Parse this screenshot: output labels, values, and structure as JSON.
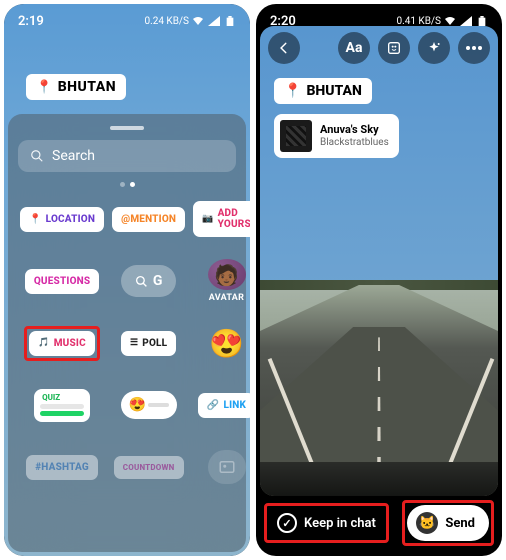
{
  "phone1": {
    "status": {
      "time": "2:19",
      "data": "0.24 KB/S"
    },
    "location": "BHUTAN",
    "search": {
      "placeholder": "Search"
    },
    "stickers": {
      "location": "LOCATION",
      "mention": "@MENTION",
      "add_yours": "ADD YOURS",
      "questions": "QUESTIONS",
      "gif": "G",
      "avatar": "AVATAR",
      "music": "MUSIC",
      "poll": "POLL",
      "quiz": "QUIZ",
      "link": "LINK",
      "hashtag": "#HASHTAG",
      "countdown": "COUNTDOWN"
    }
  },
  "phone2": {
    "status": {
      "time": "2:20",
      "data": "0.41 KB/S"
    },
    "tools": {
      "text": "Aa"
    },
    "location": "BHUTAN",
    "music": {
      "title": "Anuva's Sky",
      "artist": "Blackstratblues"
    },
    "bottom": {
      "keep": "Keep in chat",
      "send": "Send"
    }
  },
  "colors": {
    "loc_purple": "#6a3bcf",
    "mention_orange": "#f58529",
    "addyours_red": "#e1306c",
    "questions_pink": "#d62ba6",
    "music_pink": "#e1306c",
    "link_blue": "#1fa1f2",
    "hashtag_blue": "#3b82d6"
  }
}
